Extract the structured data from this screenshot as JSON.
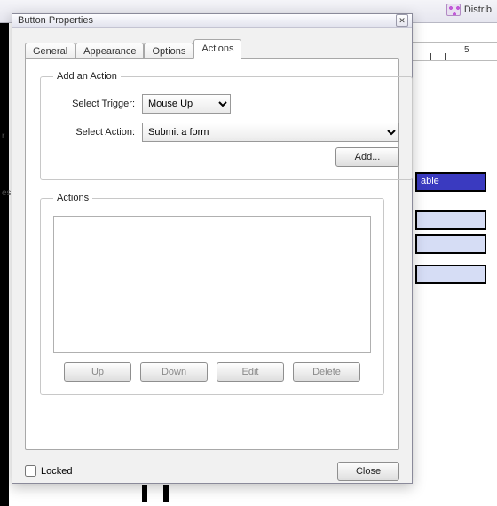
{
  "toolbar": {
    "distribute_label": "Distrib"
  },
  "dialog": {
    "title": "Button Properties"
  },
  "tabs": {
    "general": "General",
    "appearance": "Appearance",
    "options": "Options",
    "actions": "Actions"
  },
  "add_action": {
    "legend": "Add an Action",
    "trigger_label": "Select Trigger:",
    "trigger_value": "Mouse Up",
    "action_label": "Select Action:",
    "action_value": "Submit a form",
    "add_button": "Add..."
  },
  "actions_group": {
    "legend": "Actions",
    "up": "Up",
    "down": "Down",
    "edit": "Edit",
    "delete": "Delete"
  },
  "footer": {
    "locked_label": "Locked",
    "locked_checked": false,
    "close": "Close"
  },
  "background": {
    "ruler_number": "5",
    "field_label": "able"
  }
}
